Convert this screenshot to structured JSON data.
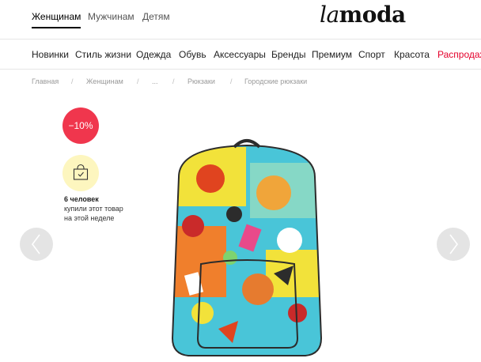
{
  "header": {
    "gender_tabs": [
      {
        "label": "Женщинам",
        "active": true
      },
      {
        "label": "Мужчинам",
        "active": false
      },
      {
        "label": "Детям",
        "active": false
      }
    ],
    "logo": {
      "part1": "la",
      "part2": "moda"
    }
  },
  "categories": [
    {
      "label": "Новинки"
    },
    {
      "label": "Стиль жизни"
    },
    {
      "label": "Одежда"
    },
    {
      "label": "Обувь"
    },
    {
      "label": "Аксессуары"
    },
    {
      "label": "Бренды"
    },
    {
      "label": "Премиум"
    },
    {
      "label": "Спорт"
    },
    {
      "label": "Красота"
    },
    {
      "label": "Распродажа",
      "color": "#e4002b"
    }
  ],
  "breadcrumb": {
    "items": [
      "Главная",
      "Женщинам",
      "...",
      "Рюкзаки",
      "Городские рюкзаки"
    ],
    "separator": "/"
  },
  "product": {
    "discount": "−10%",
    "buyers_count": "6 человек",
    "buyers_text_1": "купили этот товар",
    "buyers_text_2": "на этой неделе",
    "icons": {
      "badge": "shopping-bag-check-icon",
      "prev": "chevron-left-icon",
      "next": "chevron-right-icon"
    },
    "colors": {
      "discount": "#f0364d",
      "bag_badge": "#fdf6bf",
      "arrow_bg": "#e4e4e4"
    }
  }
}
